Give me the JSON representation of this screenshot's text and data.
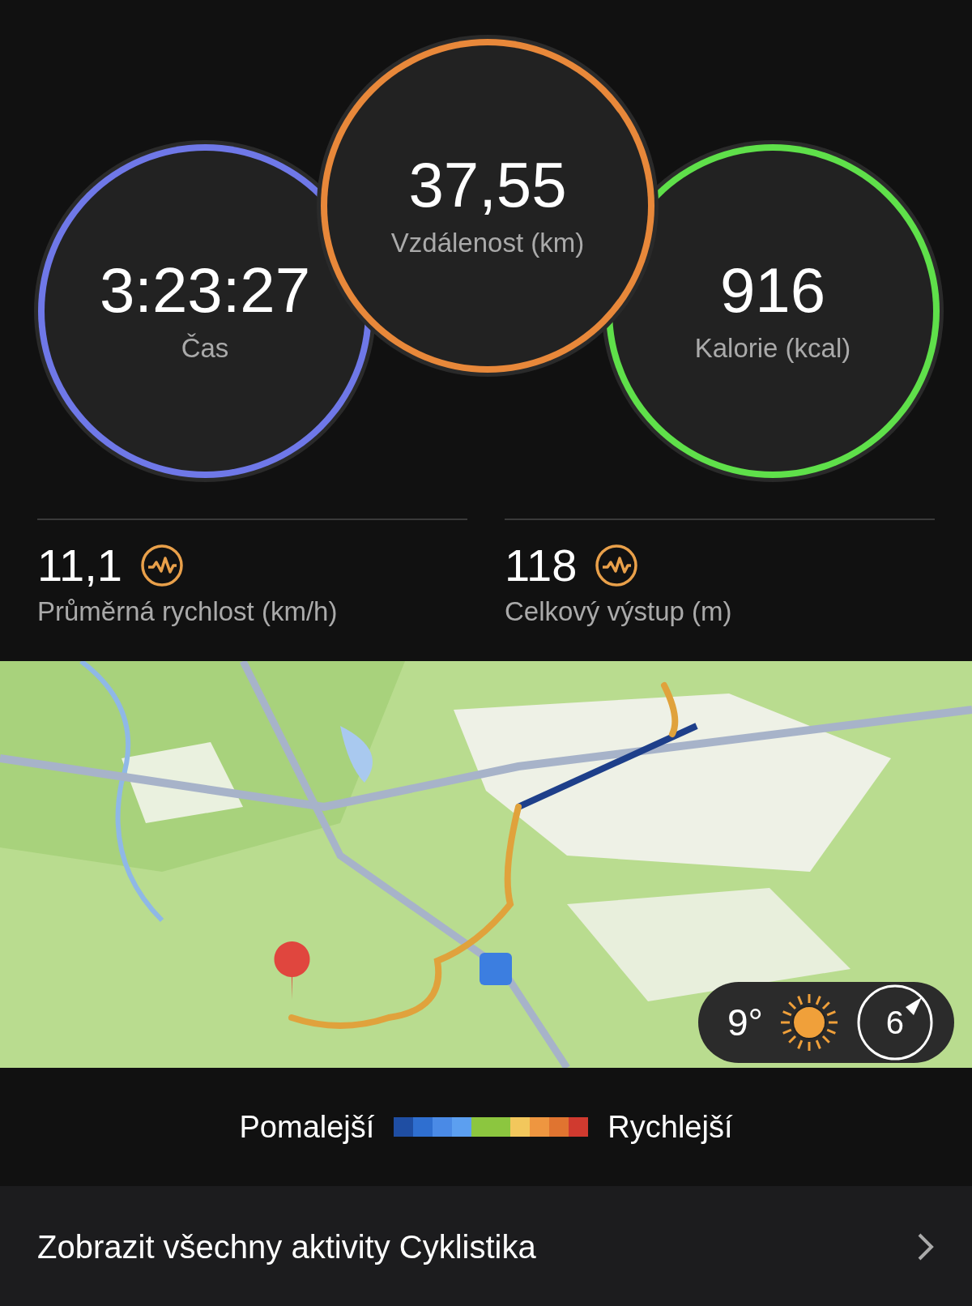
{
  "circles": [
    {
      "value": "3:23:27",
      "label": "Čas",
      "color": "#6f78e8"
    },
    {
      "value": "37,55",
      "label": "Vzdálenost (km)",
      "color": "#e8883a"
    },
    {
      "value": "916",
      "label": "Kalorie (kcal)",
      "color": "#5fe04a"
    }
  ],
  "stats": [
    {
      "value": "11,1",
      "label": "Průměrná rychlost (km/h)"
    },
    {
      "value": "118",
      "label": "Celkový výstup (m)"
    }
  ],
  "map": {
    "kind": "picture",
    "weather": {
      "temperature": "9°",
      "wind": "6"
    }
  },
  "legend": {
    "slow": "Pomalejší",
    "fast": "Rychlejší",
    "scale": [
      {
        "color": "#1f4ea3"
      },
      {
        "color": "#2f6fd0"
      },
      {
        "color": "#4a8ae6"
      },
      {
        "color": "#5c9ff0"
      },
      {
        "color": "#8cc63f"
      },
      {
        "color": "#8cc63f"
      },
      {
        "color": "#f2c75c"
      },
      {
        "color": "#ee9640"
      },
      {
        "color": "#e07430"
      },
      {
        "color": "#d03a2f"
      }
    ]
  },
  "footer": {
    "link": "Zobrazit všechny aktivity Cyklistika"
  }
}
